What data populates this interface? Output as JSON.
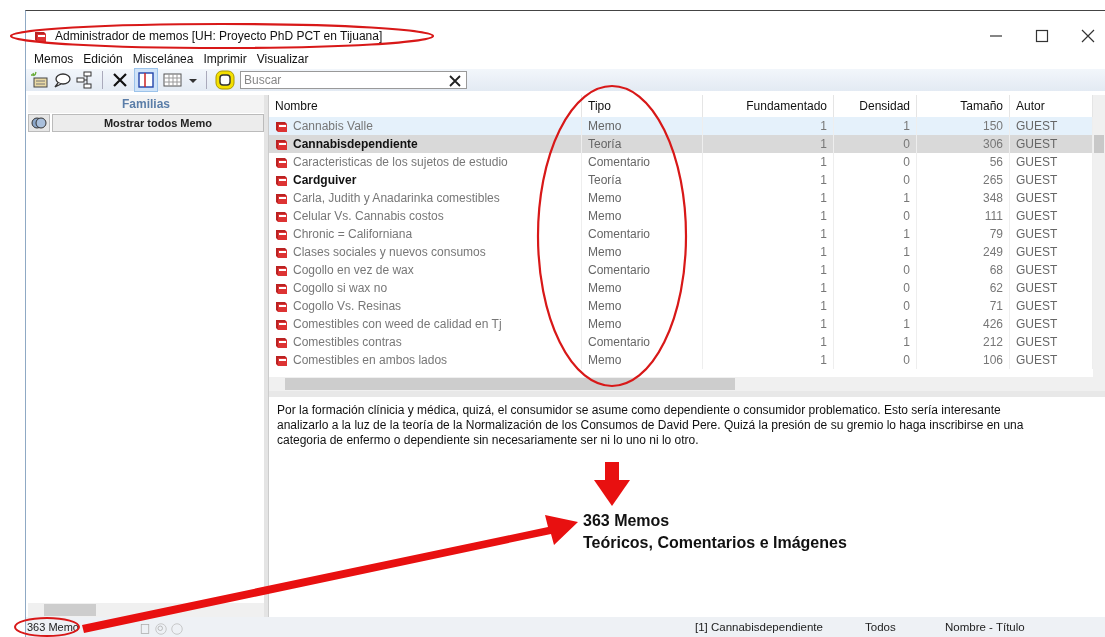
{
  "window": {
    "title": "Administrador de memos [UH: Proyecto PhD PCT en Tijuana]"
  },
  "menu": [
    "Memos",
    "Edición",
    "Miscelánea",
    "Imprimir",
    "Visualizar"
  ],
  "toolbar": {
    "search": {
      "placeholder": "Buscar"
    },
    "layout_pressed": true
  },
  "sidebar": {
    "header": "Familias",
    "show_all_button": "Mostrar todos Memo"
  },
  "table": {
    "columns": [
      "Nombre",
      "Tipo",
      "Fundamentado",
      "Densidad",
      "Tamaño",
      "Autor"
    ],
    "rows": [
      {
        "cells": [
          "Cannabis Valle",
          "Memo",
          "1",
          "1",
          "150",
          "GUEST"
        ],
        "selected": false,
        "focused": true,
        "emphasized": false
      },
      {
        "cells": [
          "Cannabisdependiente",
          "Teoría",
          "1",
          "0",
          "306",
          "GUEST"
        ],
        "selected": true,
        "focused": false,
        "emphasized": true
      },
      {
        "cells": [
          "Caracteristicas de los sujetos de estudio",
          "Comentario",
          "1",
          "0",
          "56",
          "GUEST"
        ],
        "selected": false,
        "focused": false,
        "emphasized": false
      },
      {
        "cells": [
          "Cardguiver",
          "Teoría",
          "1",
          "0",
          "265",
          "GUEST"
        ],
        "selected": false,
        "focused": false,
        "emphasized": true
      },
      {
        "cells": [
          "Carla, Judith y Anadarinka comestibles",
          "Memo",
          "1",
          "1",
          "348",
          "GUEST"
        ],
        "selected": false,
        "focused": false,
        "emphasized": false
      },
      {
        "cells": [
          "Celular Vs. Cannabis costos",
          "Memo",
          "1",
          "0",
          "111",
          "GUEST"
        ],
        "selected": false,
        "focused": false,
        "emphasized": false
      },
      {
        "cells": [
          "Chronic = Californiana",
          "Comentario",
          "1",
          "1",
          "79",
          "GUEST"
        ],
        "selected": false,
        "focused": false,
        "emphasized": false
      },
      {
        "cells": [
          "Clases sociales y nuevos consumos",
          "Memo",
          "1",
          "1",
          "249",
          "GUEST"
        ],
        "selected": false,
        "focused": false,
        "emphasized": false
      },
      {
        "cells": [
          "Cogollo en vez de wax",
          "Comentario",
          "1",
          "0",
          "68",
          "GUEST"
        ],
        "selected": false,
        "focused": false,
        "emphasized": false
      },
      {
        "cells": [
          "Cogollo si wax no",
          "Memo",
          "1",
          "0",
          "62",
          "GUEST"
        ],
        "selected": false,
        "focused": false,
        "emphasized": false
      },
      {
        "cells": [
          "Cogollo Vs. Resinas",
          "Memo",
          "1",
          "0",
          "71",
          "GUEST"
        ],
        "selected": false,
        "focused": false,
        "emphasized": false
      },
      {
        "cells": [
          "Comestibles con weed de calidad en Tj",
          "Memo",
          "1",
          "1",
          "426",
          "GUEST"
        ],
        "selected": false,
        "focused": false,
        "emphasized": false
      },
      {
        "cells": [
          "Comestibles contras",
          "Comentario",
          "1",
          "1",
          "212",
          "GUEST"
        ],
        "selected": false,
        "focused": false,
        "emphasized": false
      },
      {
        "cells": [
          "Comestibles en ambos lados",
          "Memo",
          "1",
          "0",
          "106",
          "GUEST"
        ],
        "selected": false,
        "focused": false,
        "emphasized": false
      }
    ]
  },
  "memo_text": "Por la formación clínicia y médica, quizá, el consumidor se asume como dependiente o consumidor problematico. Esto sería interesante analizarlo a la luz de la teoría de la Normalización de los Consumos de David Pere. Quizá la presión de su gremio lo haga inscribirse en una categoria de enfermo o dependiente sin necesariamente ser ni lo uno ni lo otro.",
  "status_bar": {
    "count": "363 Memo",
    "current": "[1] Cannabisdependiente",
    "filter": "Todos",
    "sort": "Nombre - Título"
  },
  "annotation": {
    "lines": [
      "363 Memos",
      "Teóricos, Comentarios e Imágenes"
    ]
  }
}
